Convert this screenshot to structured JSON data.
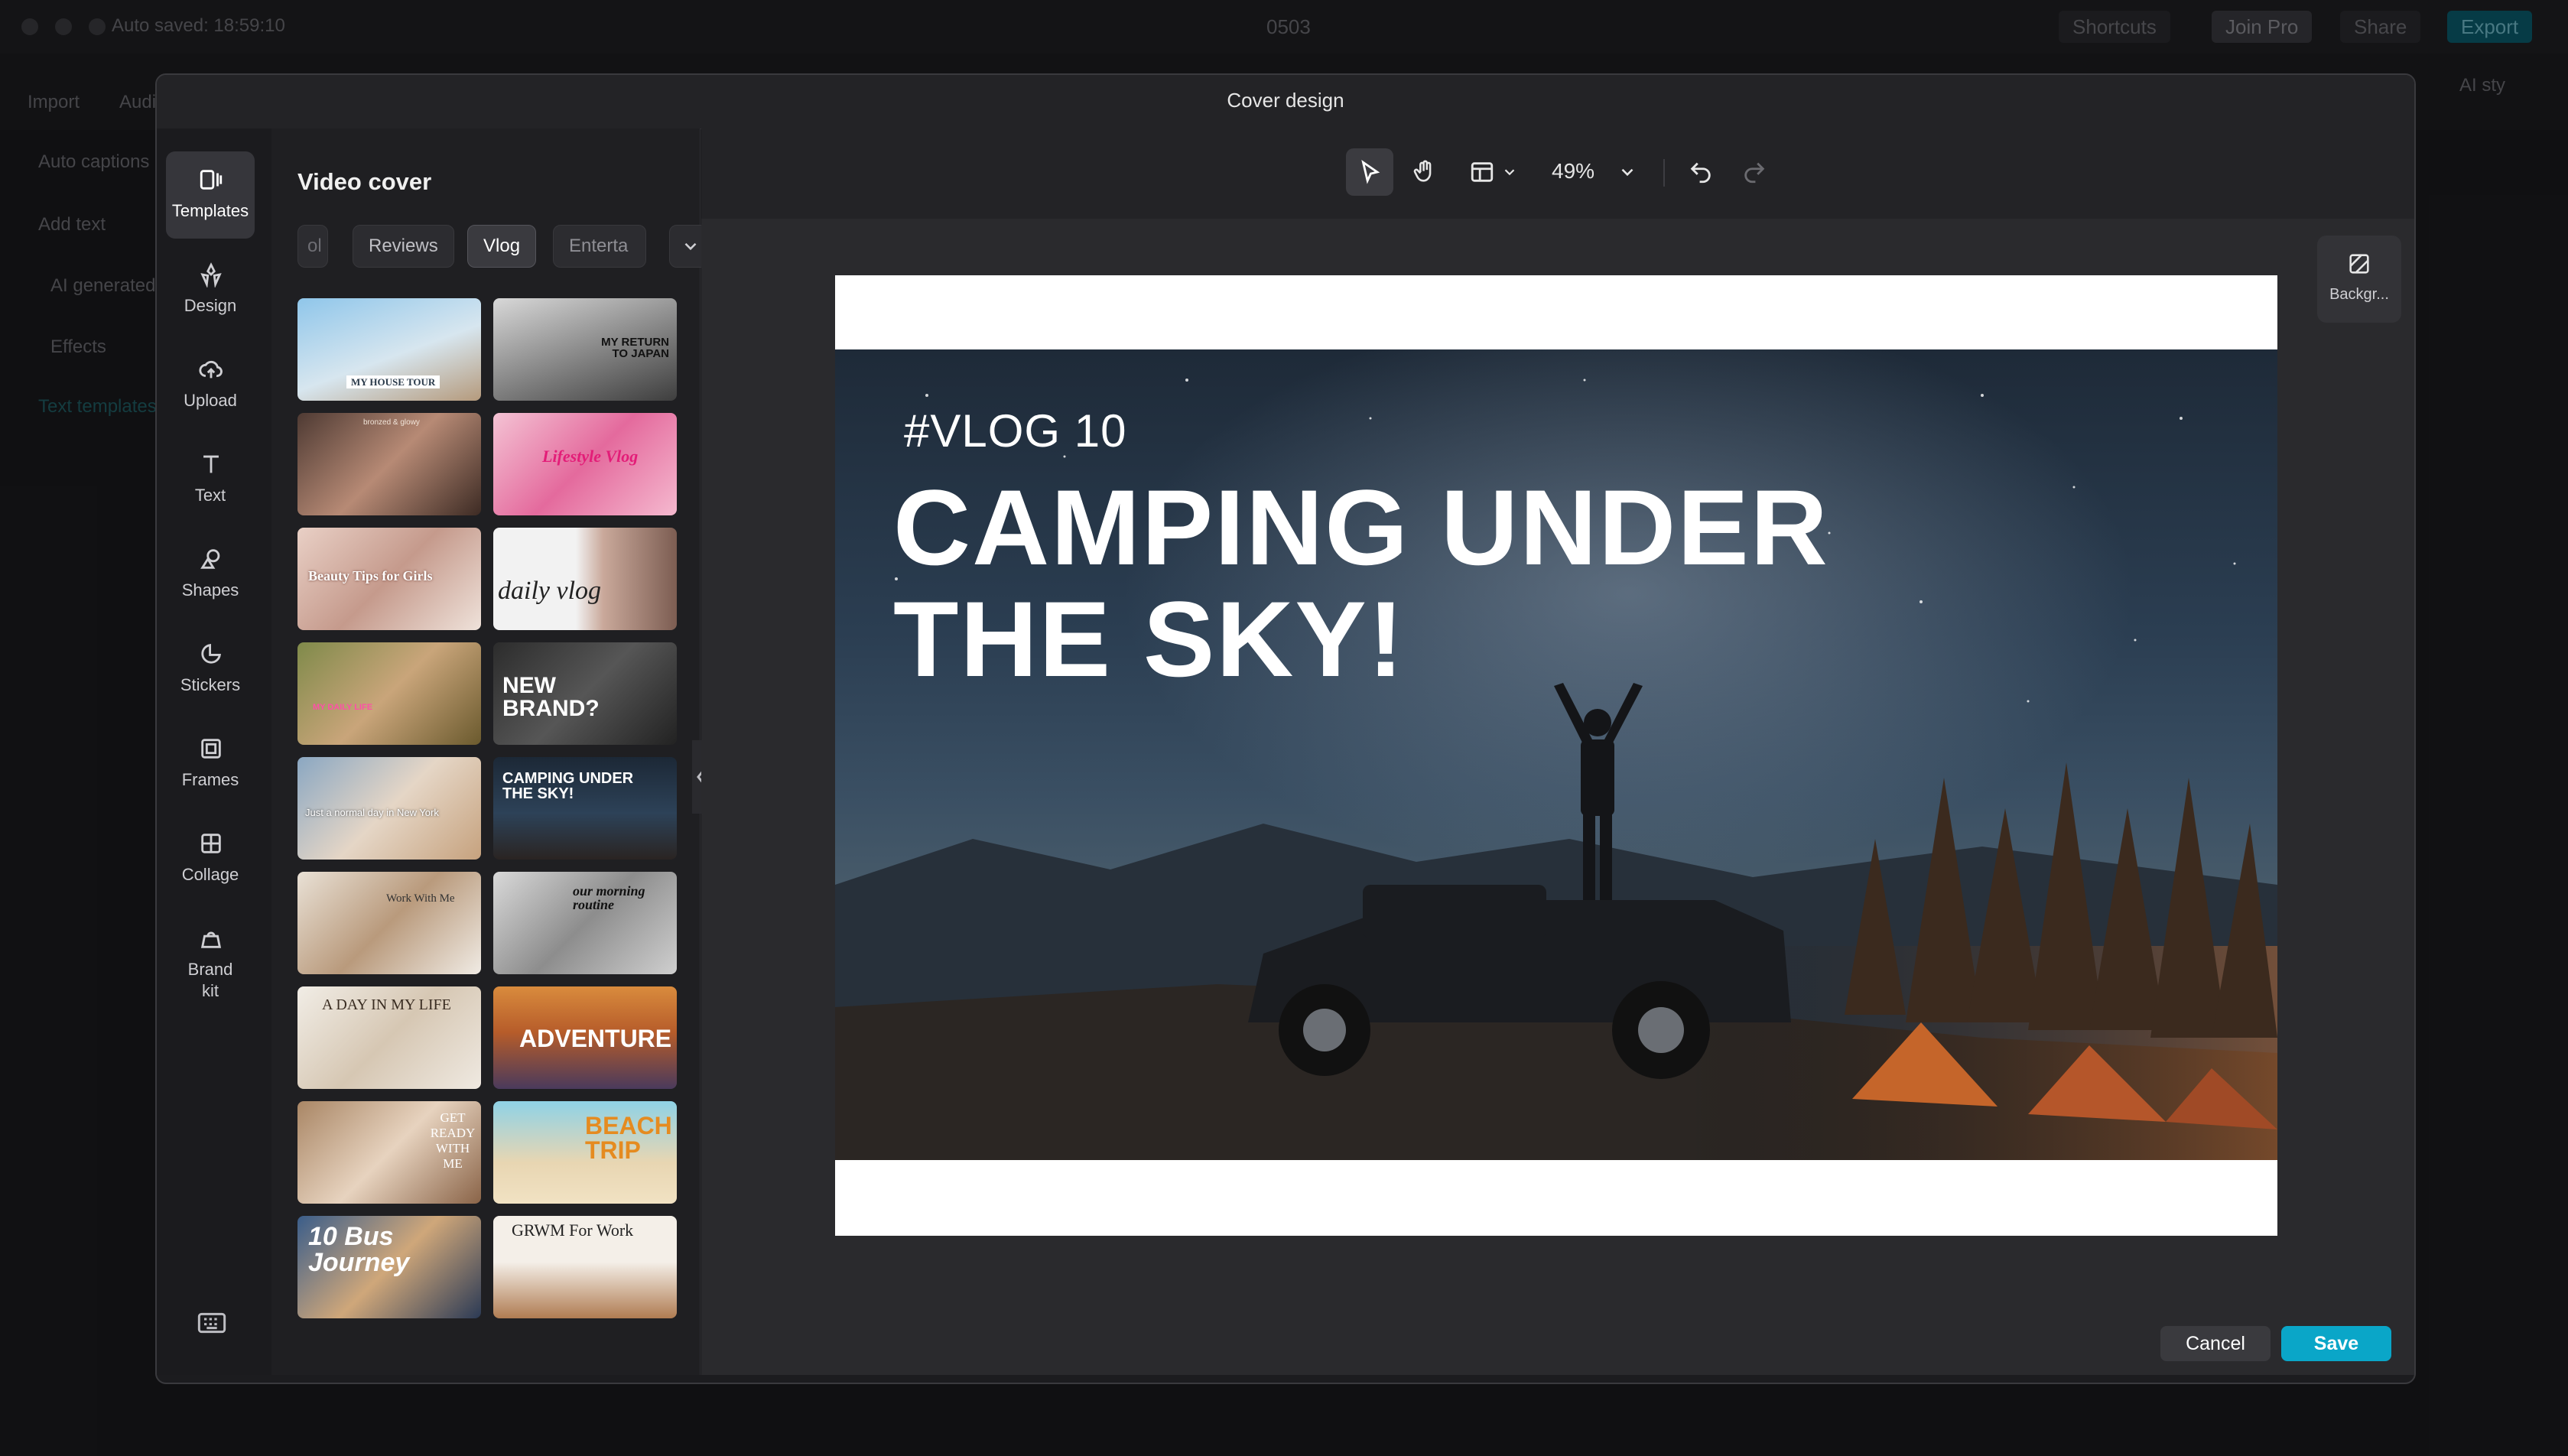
{
  "app": {
    "title": "0503",
    "autosave": "Auto saved: 18:59:10",
    "shortcuts_label": "Shortcuts",
    "join_pro_label": "Join Pro",
    "share_label": "Share",
    "export_label": "Export",
    "import_label": "Import",
    "audio_label": "Audio",
    "ai_style_label": "AI sty",
    "left_items": [
      "Auto captions",
      "Add text",
      "AI generated",
      "Effects",
      "Text templates"
    ]
  },
  "modal": {
    "title": "Cover design",
    "nav": [
      {
        "label": "Templates",
        "icon": "templates-icon"
      },
      {
        "label": "Design",
        "icon": "design-icon"
      },
      {
        "label": "Upload",
        "icon": "upload-icon"
      },
      {
        "label": "Text",
        "icon": "text-icon"
      },
      {
        "label": "Shapes",
        "icon": "shapes-icon"
      },
      {
        "label": "Stickers",
        "icon": "stickers-icon"
      },
      {
        "label": "Frames",
        "icon": "frames-icon"
      },
      {
        "label": "Collage",
        "icon": "collage-icon"
      },
      {
        "label": "Brand kit",
        "icon": "brand-kit-icon"
      }
    ],
    "panel_title": "Video cover",
    "chips": [
      "ol",
      "Reviews",
      "Vlog",
      "Enterta"
    ],
    "active_chip": "Vlog",
    "templates": [
      {
        "text": "MY HOUSE TOUR"
      },
      {
        "text": "MY RETURN TO JAPAN"
      },
      {
        "text": "bronzed & glowy"
      },
      {
        "text": "Lifestyle Vlog"
      },
      {
        "text": "Beauty Tips for Girls"
      },
      {
        "text": "daily vlog"
      },
      {
        "text": "MY DAILY LIFE"
      },
      {
        "text": "NEW BRAND?"
      },
      {
        "text": "Just a normal day in New York"
      },
      {
        "text": "CAMPING UNDER THE SKY!"
      },
      {
        "text": "Work With Me"
      },
      {
        "text": "our morning routine"
      },
      {
        "text": "A DAY IN MY LIFE"
      },
      {
        "text": "ADVENTURE"
      },
      {
        "text": "GET READY WITH ME"
      },
      {
        "text": "BEACH TRIP"
      },
      {
        "text": "10 Bus Journey"
      },
      {
        "text": "GRWM For Work"
      }
    ],
    "zoom": "49%",
    "background_tool_label": "Backgr...",
    "cover": {
      "subtitle": "#VLOG 10",
      "title_line1": "CAMPING UNDER",
      "title_line2": "THE SKY!"
    },
    "cancel_label": "Cancel",
    "save_label": "Save"
  },
  "colors": {
    "accent": "#0aa6c8",
    "modal_bg": "#1c1c1f",
    "canvas_bg": "#2a2a2d"
  }
}
